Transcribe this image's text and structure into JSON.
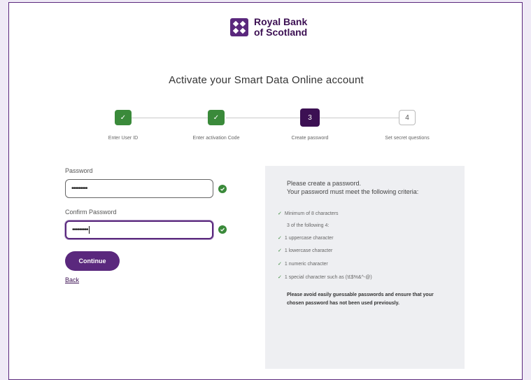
{
  "brand": {
    "name_line1": "Royal Bank",
    "name_line2": "of Scotland"
  },
  "page": {
    "title": "Activate your Smart Data Online account"
  },
  "stepper": {
    "steps": [
      {
        "number": "",
        "label": "Enter User ID",
        "state": "done"
      },
      {
        "number": "",
        "label": "Enter activation Code",
        "state": "done"
      },
      {
        "number": "3",
        "label": "Create password",
        "state": "current"
      },
      {
        "number": "4",
        "label": "Set secret questions",
        "state": "todo"
      }
    ]
  },
  "form": {
    "password_label": "Password",
    "password_value": "•••••••••",
    "confirm_label": "Confirm Password",
    "confirm_value": "•••••••••",
    "continue_label": "Continue",
    "back_label": "Back"
  },
  "criteria": {
    "intro_line1": "Please create a password.",
    "intro_line2": "Your password must meet the following criteria:",
    "min_chars": "Minimum of 8 characters",
    "subheading": "3 of the following 4:",
    "items": [
      "1 uppercase character",
      "1 lowercase character",
      "1 numeric character",
      "1 special character such as (!£$%&^-@)"
    ],
    "note": "Please avoid easily guessable passwords and ensure that your chosen password has not been used previously."
  },
  "colors": {
    "brand_purple": "#5a287d",
    "success_green": "#3a8a3a",
    "page_background": "#efeaf6"
  }
}
